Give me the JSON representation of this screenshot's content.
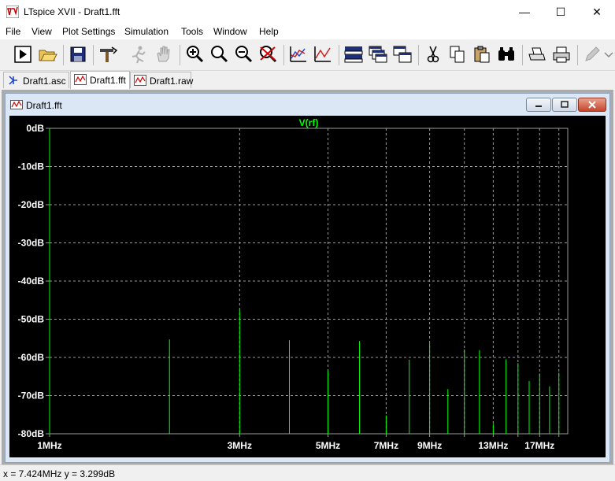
{
  "window": {
    "title": "LTspice XVII - Draft1.fft",
    "minimize": "—",
    "maximize": "☐",
    "close": "✕"
  },
  "menu": [
    "File",
    "View",
    "Plot Settings",
    "Simulation",
    "Tools",
    "Window",
    "Help"
  ],
  "toolbar": [
    "run-icon",
    "open-icon",
    "save-icon",
    "control-panel-icon",
    "run-man-icon",
    "pan-hand-icon",
    "zoom-in-icon",
    "zoom-area-icon",
    "zoom-out-icon",
    "zoom-cancel-icon",
    "autorange-icon",
    "plot-add-icon",
    "tile-horizontal-icon",
    "cascade-icon",
    "tile-vertical-icon",
    "cut-icon",
    "copy-icon",
    "paste-icon",
    "find-icon",
    "print-setup-icon",
    "print-icon",
    "edit-pencil-icon",
    "more-icon"
  ],
  "tabs": [
    {
      "label": "Draft1.asc",
      "active": false
    },
    {
      "label": "Draft1.fft",
      "active": true
    },
    {
      "label": "Draft1.raw",
      "active": false
    }
  ],
  "mdi": {
    "title": "Draft1.fft"
  },
  "status": {
    "text": "x = 7.424MHz   y = 3.299dB"
  },
  "colors": {
    "trace": "#00ff00",
    "grid": "#9a9a9a",
    "plot_bg": "#000000",
    "axis_text": "#ffffff",
    "title_text": "#00ff00"
  },
  "chart_data": {
    "type": "bar",
    "title": "V(rf)",
    "xlabel": "",
    "ylabel": "",
    "x_scale": "log",
    "xlim": [
      1,
      20
    ],
    "ylim": [
      -80,
      0
    ],
    "grid": true,
    "x_ticks": [
      {
        "value": 1,
        "label": "1MHz"
      },
      {
        "value": 3,
        "label": "3MHz"
      },
      {
        "value": 5,
        "label": "5MHz"
      },
      {
        "value": 7,
        "label": "7MHz"
      },
      {
        "value": 9,
        "label": "9MHz"
      },
      {
        "value": 13,
        "label": "13MHz"
      },
      {
        "value": 17,
        "label": "17MHz"
      }
    ],
    "x_minor_grid": [
      11,
      15,
      19
    ],
    "y_ticks": [
      {
        "value": 0,
        "label": "0dB"
      },
      {
        "value": -10,
        "label": "-10dB"
      },
      {
        "value": -20,
        "label": "-20dB"
      },
      {
        "value": -30,
        "label": "-30dB"
      },
      {
        "value": -40,
        "label": "-40dB"
      },
      {
        "value": -50,
        "label": "-50dB"
      },
      {
        "value": -60,
        "label": "-60dB"
      },
      {
        "value": -70,
        "label": "-70dB"
      },
      {
        "value": -80,
        "label": "-80dB"
      }
    ],
    "series": [
      {
        "points": [
          {
            "x": 1.0,
            "y": 0
          },
          {
            "x": 2.0,
            "y": -55.3
          },
          {
            "x": 3.0,
            "y": -47.4
          },
          {
            "x": 4.0,
            "y": -55.5
          },
          {
            "x": 5.0,
            "y": -63.4
          },
          {
            "x": 6.0,
            "y": -55.7
          },
          {
            "x": 7.0,
            "y": -75.2
          },
          {
            "x": 8.0,
            "y": -60.6
          },
          {
            "x": 9.0,
            "y": -56.3
          },
          {
            "x": 10.0,
            "y": -68.3
          },
          {
            "x": 11.0,
            "y": -57.9
          },
          {
            "x": 12.0,
            "y": -58.1
          },
          {
            "x": 13.0,
            "y": -77.4
          },
          {
            "x": 14.0,
            "y": -60.5
          },
          {
            "x": 15.0,
            "y": -61.5
          },
          {
            "x": 16.0,
            "y": -66.2
          },
          {
            "x": 17.0,
            "y": -64.2
          },
          {
            "x": 18.0,
            "y": -67.6
          },
          {
            "x": 19.0,
            "y": -64.0
          }
        ]
      }
    ]
  }
}
